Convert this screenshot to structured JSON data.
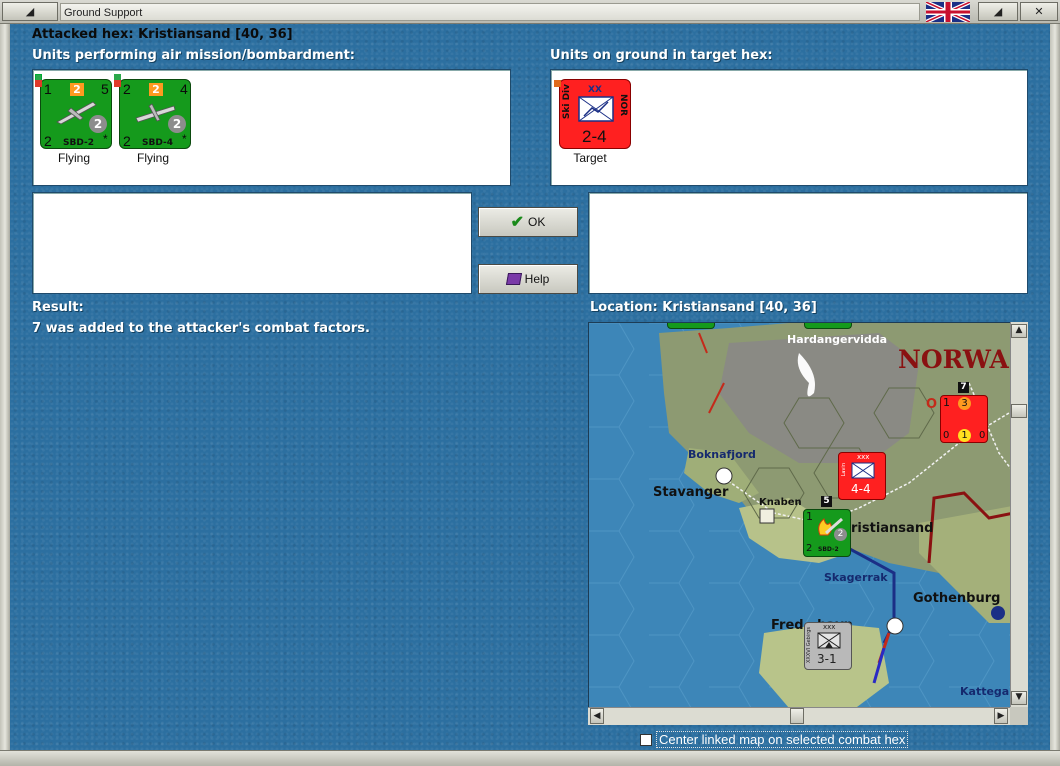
{
  "window": {
    "title": "Ground Support",
    "menu_icon": "window-menu-icon",
    "close_symbol": "✕",
    "restore_symbol": "◢"
  },
  "header": {
    "attacked_hex": "Attacked hex: Kristiansand  [40, 36]"
  },
  "attackers": {
    "label": "Units performing air mission/bombardment:",
    "units": [
      {
        "name": "SBD-2",
        "attack": "2",
        "range": "5",
        "top_left": "1",
        "bottom_left": "2",
        "steps": "2",
        "mark": "*",
        "status": "Flying"
      },
      {
        "name": "SBD-4",
        "attack": "2",
        "range": "4",
        "top_left": "2",
        "bottom_left": "2",
        "steps": "2",
        "mark": "*",
        "status": "Flying"
      }
    ]
  },
  "defenders": {
    "label": "Units on ground in target hex:",
    "units": [
      {
        "type": "Ski Div",
        "size": "XX",
        "nation": "NOR",
        "strength": "2-4",
        "status": "Target"
      }
    ]
  },
  "buttons": {
    "ok": "OK",
    "help": "Help"
  },
  "result": {
    "label": "Result:",
    "text": "7 was added to the attacker's combat factors."
  },
  "location": {
    "label": "Location:  Kristiansand  [40, 36]"
  },
  "map": {
    "labels": {
      "norway": "NORWA",
      "hardanger": "Hardangervidda",
      "boknafjord": "Boknafjord",
      "stavanger": "Stavanger",
      "knaben": "Knaben",
      "kristiansand": "ristiansand",
      "skagerrak": "Skagerrak",
      "gothenburg": "Gothenburg",
      "frederikshavn": "Fred   havn",
      "kattegat": "Kattega"
    },
    "units": {
      "xxx_top": {
        "size": "xxx",
        "label": "Lavin",
        "strength": "4-4"
      },
      "stack_top": {
        "top_left": "1",
        "attack": "3",
        "count": "7",
        "circle": "1",
        "bottom_left": "0",
        "bottom_right": "0"
      },
      "air_stack": {
        "top_left": "1",
        "steps": "2",
        "bottom_left": "2",
        "name": "SBD-2",
        "count": "5"
      },
      "grey_unit": {
        "size": "xxx",
        "type": "XXXVI Gebirgs",
        "strength": "3-1"
      }
    }
  },
  "center_checkbox": {
    "label": "Center linked map on selected combat hex",
    "checked": false
  },
  "colors": {
    "background": "#2c6fa0",
    "allied_air": "#159a1c",
    "target": "#ff2020",
    "frame": "#c2c2b8"
  }
}
